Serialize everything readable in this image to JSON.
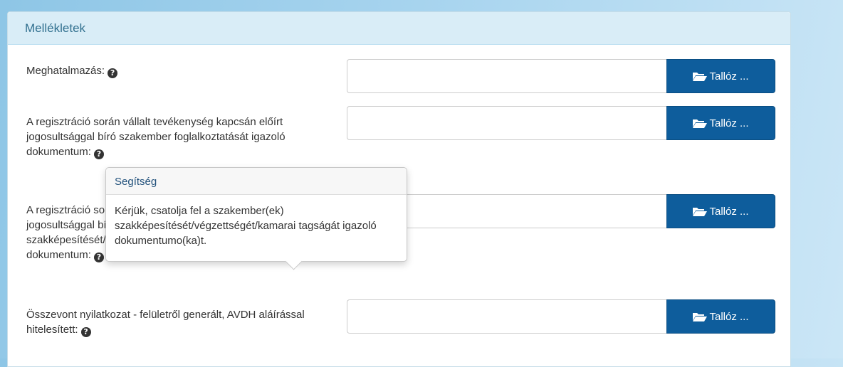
{
  "panel": {
    "title": "Mellékletek"
  },
  "browse_label": "Tallóz ...",
  "rows": [
    {
      "label": "Meghatalmazás:"
    },
    {
      "label": "A regisztráció során vállalt tevékenység kapcsán előírt jogosultsággal bíró szakember foglalkoztatását igazoló dokumentum:"
    },
    {
      "label": "A regisztráció során vállalt tevékenység kapcsán előírt jogosultsággal bíró szakember szakképesítését/végzettségét/kamarai tagságát igazoló dokumentum:"
    },
    {
      "label": "Összevont nyilatkozat - felületről generált, AVDH aláírással hitelesített:"
    }
  ],
  "popover": {
    "title": "Segítség",
    "body": "Kérjük, csatolja fel a szakember(ek) szakképesítését/végzettségét/kamarai tagságát igazoló dokumentumo(ka)t."
  },
  "icons": {
    "help": "question-circle-icon",
    "folder": "folder-open-icon"
  },
  "colors": {
    "accent": "#0e5d9c",
    "heading_bg": "#d9edf7",
    "heading_text": "#31708f"
  }
}
